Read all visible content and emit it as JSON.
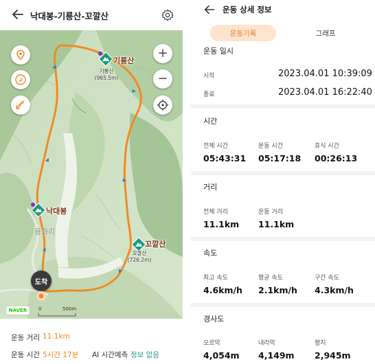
{
  "left": {
    "header": {
      "title": "낙대봉-기룡산-꼬깔산"
    },
    "map": {
      "peaks": [
        {
          "name": "기룡산",
          "sub_name": "기룡산",
          "elevation": "(965.5m)"
        },
        {
          "name": "꼬깔산",
          "sub_name": "꼬깔산",
          "elevation": "(726.2m)"
        },
        {
          "name": "낙대봉"
        }
      ],
      "village": "용화리",
      "end_badge": "도착",
      "logo": "NAVER",
      "scale_zero": "0",
      "scale_label": "500m",
      "buttons": {
        "location": "location-pin-icon",
        "compass": "compass-icon",
        "measure": "ruler-icon",
        "zoom_in": "+",
        "zoom_out": "−",
        "gps": "crosshair-icon"
      },
      "route_color": "#f08a24"
    },
    "footer": {
      "distance_label": "운동 거리",
      "distance_value": "11.1km",
      "time_label": "운동 시간",
      "time_value": "5시간 17분",
      "ai_label": "AI 시간예측",
      "ai_value": "정보 없음"
    }
  },
  "right": {
    "header": {
      "title": "운동 상세 정보"
    },
    "tabs": [
      {
        "label": "운동기록",
        "active": true
      },
      {
        "label": "그래프",
        "active": false
      }
    ],
    "workout_date": {
      "title": "운동 일시",
      "start_label": "시작",
      "start_value": "2023.04.01 10:39:09",
      "end_label": "종료",
      "end_value": "2023.04.01 16:22:40"
    },
    "time": {
      "title": "시간",
      "items": [
        {
          "label": "전체 시간",
          "value": "05:43:31"
        },
        {
          "label": "운동 시간",
          "value": "05:17:18"
        },
        {
          "label": "휴식 시간",
          "value": "00:26:13"
        }
      ]
    },
    "distance": {
      "title": "거리",
      "items": [
        {
          "label": "전체 거리",
          "value": "11.1km"
        },
        {
          "label": "운동 거리",
          "value": "11.1km"
        }
      ]
    },
    "speed": {
      "title": "속도",
      "items": [
        {
          "label": "최고 속도",
          "value": "4.6km/h"
        },
        {
          "label": "평균 속도",
          "value": "2.1km/h"
        },
        {
          "label": "구간 속도",
          "value": "4.3km/h"
        }
      ]
    },
    "slope": {
      "title": "경사도",
      "items": [
        {
          "label": "오르막",
          "value": "4,054m"
        },
        {
          "label": "내리막",
          "value": "4,149m"
        },
        {
          "label": "평지",
          "value": "2,945m"
        }
      ]
    },
    "accent_color": "#ef7d2a"
  }
}
